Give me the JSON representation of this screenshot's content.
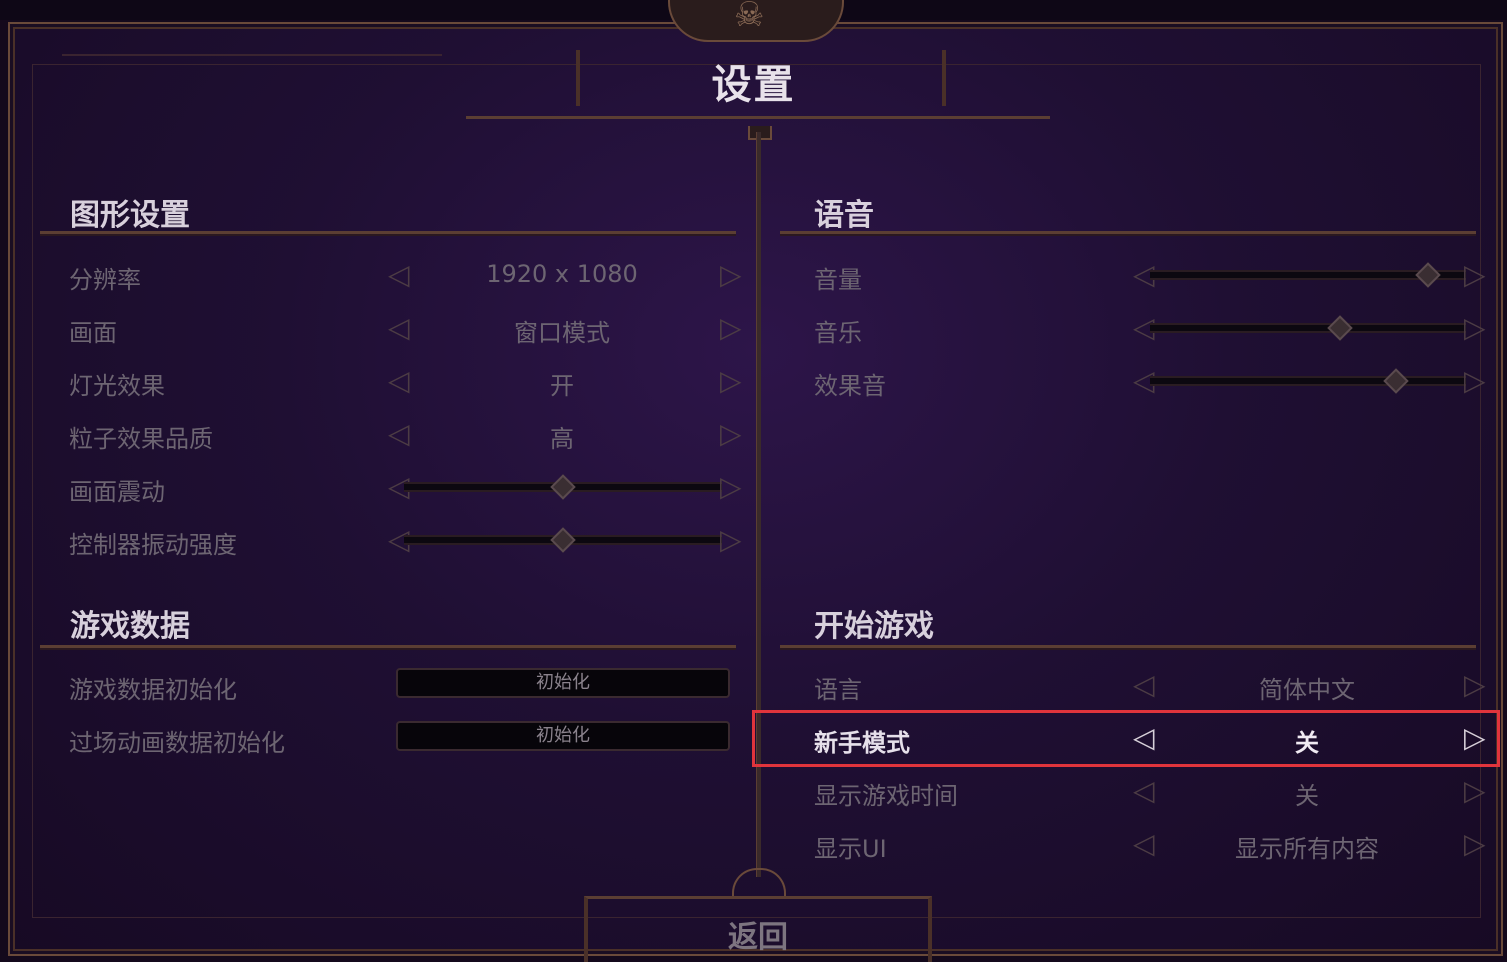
{
  "title": "设置",
  "back_label": "返回",
  "graphics": {
    "title": "图形设置",
    "resolution": {
      "label": "分辨率",
      "value": "1920 x 1080"
    },
    "display": {
      "label": "画面",
      "value": "窗口模式"
    },
    "lighting": {
      "label": "灯光效果",
      "value": "开"
    },
    "particles": {
      "label": "粒子效果品质",
      "value": "高"
    },
    "screen_shake": {
      "label": "画面震动",
      "level": 0.5
    },
    "controller_vibration": {
      "label": "控制器振动强度",
      "level": 0.5
    }
  },
  "game_data": {
    "title": "游戏数据",
    "reset_data": {
      "label": "游戏数据初始化",
      "button": "初始化"
    },
    "reset_cutscene": {
      "label": "过场动画数据初始化",
      "button": "初始化"
    }
  },
  "audio": {
    "title": "语音",
    "volume": {
      "label": "音量",
      "level": 0.88
    },
    "music": {
      "label": "音乐",
      "level": 0.6
    },
    "sfx": {
      "label": "效果音",
      "level": 0.78
    }
  },
  "start_game": {
    "title": "开始游戏",
    "language": {
      "label": "语言",
      "value": "简体中文"
    },
    "beginner_mode": {
      "label": "新手模式",
      "value": "关"
    },
    "show_play_time": {
      "label": "显示游戏时间",
      "value": "关"
    },
    "show_ui": {
      "label": "显示UI",
      "value": "显示所有内容"
    }
  },
  "icons": {
    "left_arrow": "left-arrow-icon",
    "right_arrow": "right-arrow-icon",
    "skull": "skull-ornament-icon"
  },
  "colors": {
    "highlight": "#e0343c",
    "background": "#1f0f33"
  }
}
